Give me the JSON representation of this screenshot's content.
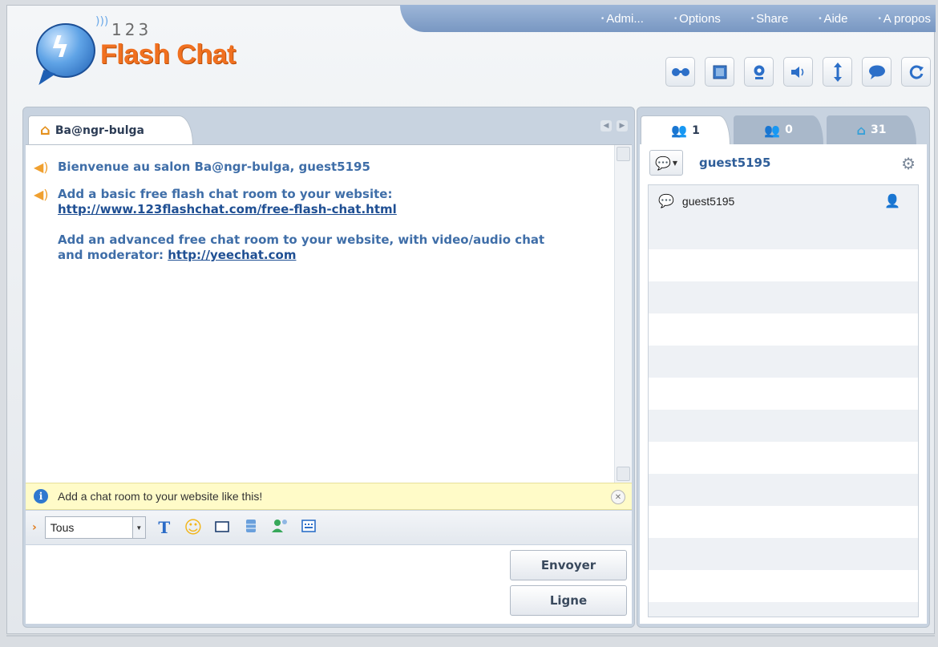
{
  "logo": {
    "number": "123",
    "name": "Flash Chat"
  },
  "menu": [
    "Admi...",
    "Options",
    "Share",
    "Aide",
    "A propos"
  ],
  "toolbar": [
    {
      "icon": "glasses-icon"
    },
    {
      "icon": "screen-icon"
    },
    {
      "icon": "webcam-icon"
    },
    {
      "icon": "speaker-icon"
    },
    {
      "icon": "resize-vertical-icon"
    },
    {
      "icon": "chat-bubble-icon"
    },
    {
      "icon": "refresh-icon"
    }
  ],
  "room": {
    "tab_label": "Ba@ngr-bulga"
  },
  "messages": [
    {
      "text": "Bienvenue au salon Ba@ngr-bulga, guest5195"
    },
    {
      "line1": "Add a basic free flash chat room to your website:",
      "link1": "http://www.123flashchat.com/free-flash-chat.html",
      "line2": "Add an advanced free chat room to your website, with video/audio chat",
      "line3": "and moderator: ",
      "link2": "http://yeechat.com"
    }
  ],
  "notice": {
    "text": "Add a chat room to your website like this!"
  },
  "input": {
    "recipient": "Tous"
  },
  "buttons": {
    "send": "Envoyer",
    "line": "Ligne"
  },
  "users_tabs": [
    {
      "count": "1"
    },
    {
      "count": "0"
    },
    {
      "count": "31"
    }
  ],
  "current_user": "guest5195",
  "user_list": [
    {
      "name": "guest5195"
    }
  ],
  "colors": {
    "accent": "#3f6ea8",
    "brand": "#f07020",
    "menu_bg": "#7897c2",
    "notice_bg": "#fffbc8"
  }
}
